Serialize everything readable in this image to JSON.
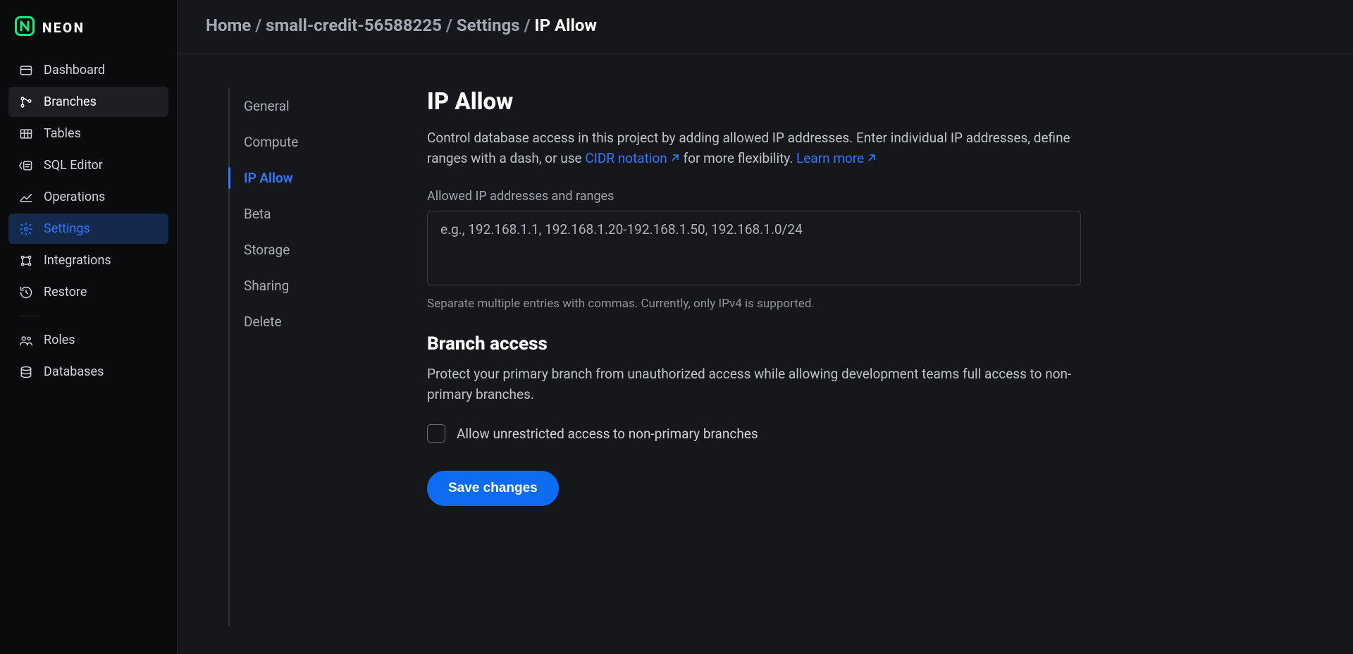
{
  "brand": {
    "name": "NEON"
  },
  "sidebar": {
    "items": [
      {
        "label": "Dashboard",
        "icon": "dashboard",
        "state": ""
      },
      {
        "label": "Branches",
        "icon": "branches",
        "state": "hover"
      },
      {
        "label": "Tables",
        "icon": "tables",
        "state": ""
      },
      {
        "label": "SQL Editor",
        "icon": "sql-editor",
        "state": ""
      },
      {
        "label": "Operations",
        "icon": "operations",
        "state": ""
      },
      {
        "label": "Settings",
        "icon": "settings",
        "state": "active"
      },
      {
        "label": "Integrations",
        "icon": "integrations",
        "state": ""
      },
      {
        "label": "Restore",
        "icon": "restore",
        "state": ""
      }
    ],
    "secondary": [
      {
        "label": "Roles",
        "icon": "roles"
      },
      {
        "label": "Databases",
        "icon": "databases"
      }
    ]
  },
  "breadcrumb": {
    "items": [
      "Home",
      "small-credit-56588225",
      "Settings",
      "IP Allow"
    ]
  },
  "settings_tabs": [
    "General",
    "Compute",
    "IP Allow",
    "Beta",
    "Storage",
    "Sharing",
    "Delete"
  ],
  "settings_active": "IP Allow",
  "panel": {
    "title": "IP Allow",
    "desc_before": "Control database access in this project by adding allowed IP addresses. Enter individual IP addresses, define ranges with a dash, or use ",
    "cidr_link": "CIDR notation",
    "desc_mid": " for more flexibility. ",
    "learn_more": "Learn more",
    "ip_label": "Allowed IP addresses and ranges",
    "ip_placeholder": "e.g., 192.168.1.1, 192.168.1.20-192.168.1.50, 192.168.1.0/24",
    "ip_helper": "Separate multiple entries with commas. Currently, only IPv4 is supported.",
    "branch_title": "Branch access",
    "branch_desc": "Protect your primary branch from unauthorized access while allowing development teams full access to non-primary branches.",
    "checkbox_label": "Allow unrestricted access to non-primary branches",
    "save_label": "Save changes"
  }
}
